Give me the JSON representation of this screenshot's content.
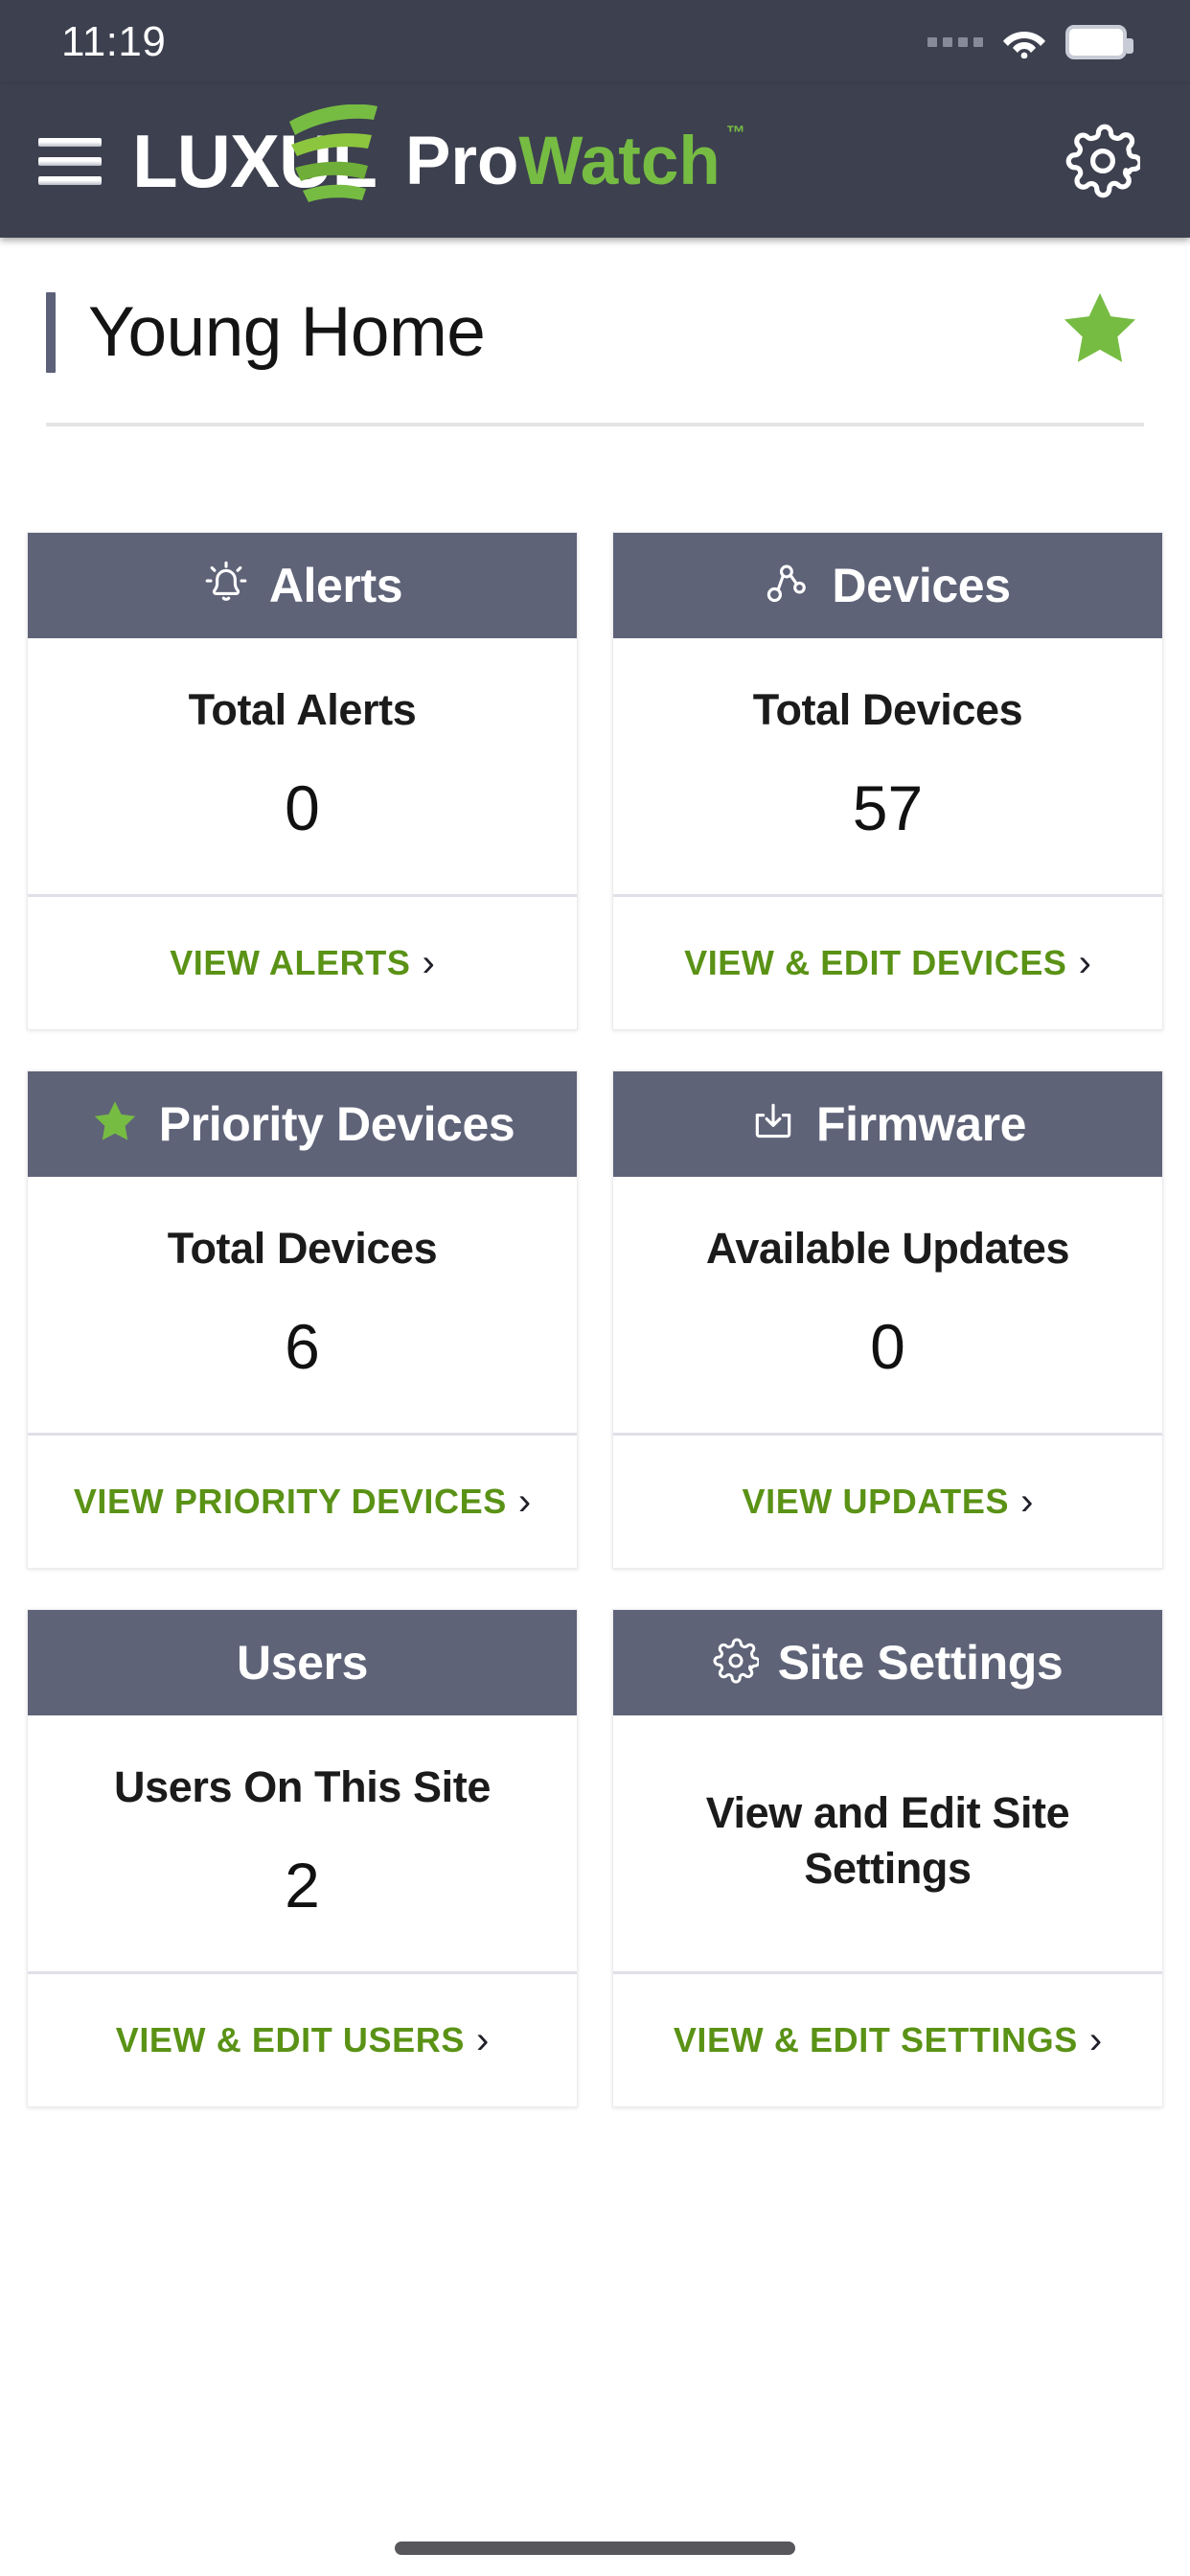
{
  "status_bar": {
    "time": "11:19",
    "icons": [
      "signal-dots-icon",
      "wifi-icon",
      "battery-icon"
    ]
  },
  "app_bar": {
    "menu_icon": "hamburger-menu-icon",
    "brand_luxul": "LUXUL",
    "brand_pro": "Pro",
    "brand_watch": "Watch",
    "brand_tm": "™",
    "settings_icon": "gear-icon"
  },
  "page": {
    "title": "Young Home",
    "favorite_icon": "star-icon"
  },
  "colors": {
    "header_bg": "#3d404f",
    "card_head_bg": "#5f6378",
    "accent_green": "#76bc43",
    "link_green": "#5a9216",
    "title_bar": "#5c6078"
  },
  "cards": [
    {
      "id": "alerts",
      "icon": "alert-bell-icon",
      "title": "Alerts",
      "label": "Total Alerts",
      "value": "0",
      "link": "VIEW ALERTS",
      "chevron": "›"
    },
    {
      "id": "devices",
      "icon": "device-network-icon",
      "title": "Devices",
      "label": "Total Devices",
      "value": "57",
      "link": "VIEW & EDIT DEVICES",
      "chevron": "›"
    },
    {
      "id": "priority-devices",
      "icon": "star-icon",
      "title": "Priority Devices",
      "label": "Total Devices",
      "value": "6",
      "link": "VIEW PRIORITY DEVICES",
      "chevron": "›"
    },
    {
      "id": "firmware",
      "icon": "firmware-download-icon",
      "title": "Firmware",
      "label": "Available Updates",
      "value": "0",
      "link": "VIEW UPDATES",
      "chevron": "›"
    },
    {
      "id": "users",
      "icon": "",
      "title": "Users",
      "label": "Users On This Site",
      "value": "2",
      "link": "VIEW & EDIT USERS",
      "chevron": "›"
    },
    {
      "id": "site-settings",
      "icon": "gear-icon",
      "title": "Site Settings",
      "label": "View and Edit Site Settings",
      "value": "",
      "link": "VIEW & EDIT SETTINGS",
      "chevron": "›"
    }
  ]
}
